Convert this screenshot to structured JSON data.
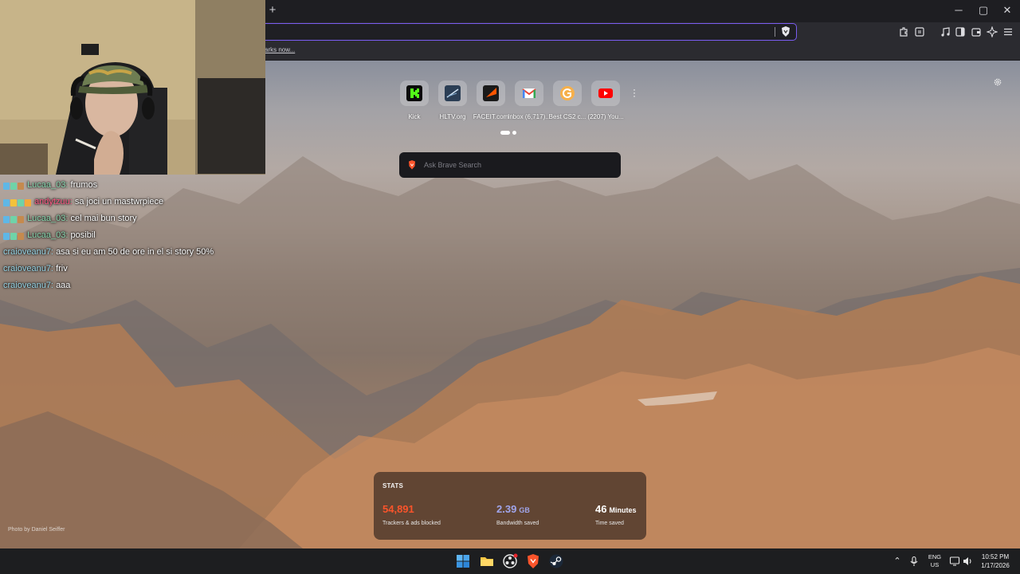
{
  "browser": {
    "bookmarks_link": "arks now...",
    "new_tab_symbol": "+",
    "window_controls": {
      "minimize": "─",
      "maximize": "▢",
      "close": "✕"
    }
  },
  "chat": {
    "messages": [
      {
        "user": "Lucaa_03:",
        "text": "frumos",
        "user_color": "#8ad8b0",
        "badges": true
      },
      {
        "user": "andytzuu:",
        "text": "sa joci un mastwrpiece",
        "user_color": "#ff5a86",
        "badges": true
      },
      {
        "user": "Lucaa_03:",
        "text": "cel mai bun story",
        "user_color": "#8ad8b0",
        "badges": true
      },
      {
        "user": "Lucaa_03:",
        "text": "posibil",
        "user_color": "#8ad8b0",
        "badges": true
      },
      {
        "user": "craioveanu7:",
        "text": "asa si eu am 50 de ore in el si story 50%",
        "user_color": "#9ad7e8",
        "badges": false
      },
      {
        "user": "craioveanu7:",
        "text": "friv",
        "user_color": "#9ad7e8",
        "badges": false
      },
      {
        "user": "craioveanu7:",
        "text": "aaa",
        "user_color": "#9ad7e8",
        "badges": false
      }
    ]
  },
  "new_tab": {
    "top_sites": [
      {
        "label": "Kick",
        "icon": "kick-icon",
        "color": "#53fc18"
      },
      {
        "label": "HLTV.org",
        "icon": "hltv-icon",
        "color": "#2b6ea6"
      },
      {
        "label": "FACEIT.com",
        "icon": "faceit-icon",
        "color": "#ff5500"
      },
      {
        "label": "Inbox (6,717)...",
        "icon": "gmail-icon",
        "color": "#ea4335"
      },
      {
        "label": "Best CS2 c...",
        "icon": "site-g-icon",
        "color": "#f2994a"
      },
      {
        "label": "(2207) You...",
        "icon": "youtube-icon",
        "color": "#ff0000"
      }
    ],
    "search_placeholder": "Ask Brave Search",
    "photo_credit": "Photo by Daniel Seiffer"
  },
  "stats": {
    "heading": "STATS",
    "items": [
      {
        "value": "54,891",
        "unit": "",
        "label": "Trackers & ads blocked",
        "color": "#fb542b"
      },
      {
        "value": "2.39",
        "unit": "GB",
        "label": "Bandwidth saved",
        "color": "#a0a5eb"
      },
      {
        "value": "46",
        "unit": "Minutes",
        "label": "Time saved",
        "color": "#ffffff"
      }
    ]
  },
  "taskbar": {
    "language": "ENG",
    "region": "US",
    "time": "10:52 PM",
    "date": "1/17/2026"
  }
}
